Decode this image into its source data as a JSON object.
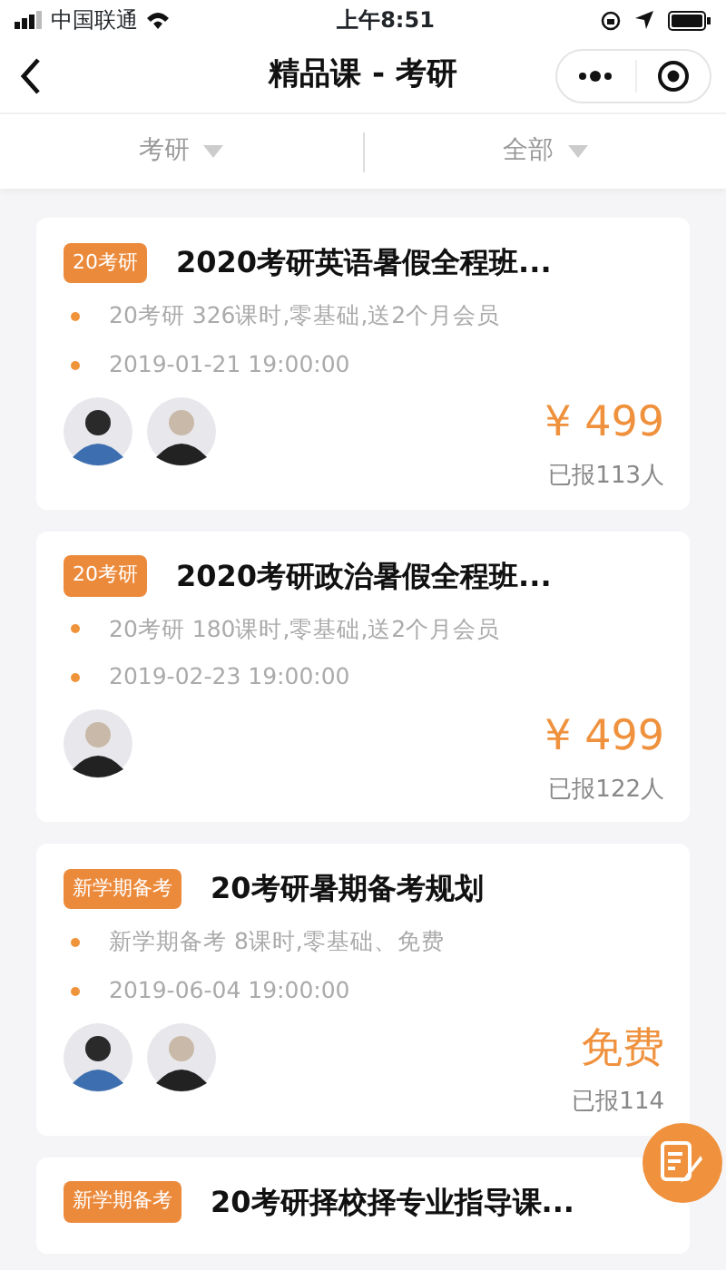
{
  "status_bar": {
    "carrier": "中国联通",
    "time": "上午8:51"
  },
  "nav": {
    "title": "精品课 - 考研"
  },
  "filters": [
    {
      "label": "考研"
    },
    {
      "label": "全部"
    }
  ],
  "courses": [
    {
      "tag": "20考研",
      "title": "2020考研英语暑假全程班...",
      "desc": "20考研 326课时,零基础,送2个月会员",
      "date": "2019-01-21 19:00:00",
      "teachers": [
        {
          "kind": "avatar"
        },
        {
          "kind": "avatar"
        }
      ],
      "price": "¥ 499",
      "enrolled": "已报113人"
    },
    {
      "tag": "20考研",
      "title": "2020考研政治暑假全程班...",
      "desc": "20考研 180课时,零基础,送2个月会员",
      "date": "2019-02-23 19:00:00",
      "teachers": [
        {
          "kind": "avatar"
        }
      ],
      "price": "¥ 499",
      "enrolled": "已报122人"
    },
    {
      "tag": "新学期备考",
      "title": "20考研暑期备考规划",
      "desc": "新学期备考 8课时,零基础、免费",
      "date": "2019-06-04 19:00:00",
      "teachers": [
        {
          "kind": "avatar"
        },
        {
          "kind": "avatar"
        }
      ],
      "price": "免费",
      "enrolled": "已报114"
    },
    {
      "tag": "新学期备考",
      "title": "20考研择校择专业指导课..."
    }
  ]
}
